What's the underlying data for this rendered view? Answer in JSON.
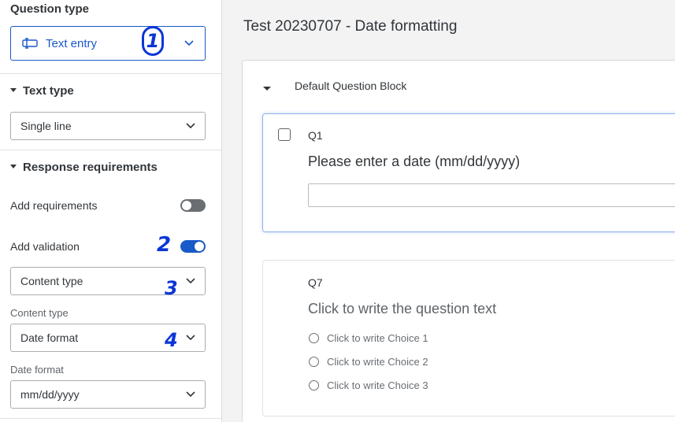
{
  "sidebar": {
    "question_type": {
      "heading": "Question type",
      "selected": "Text entry",
      "icon": "text-entry-icon"
    },
    "text_type": {
      "heading": "Text type",
      "selected": "Single line"
    },
    "response_requirements": {
      "heading": "Response requirements",
      "add_requirements_label": "Add requirements",
      "add_requirements_on": false,
      "add_validation_label": "Add validation",
      "add_validation_on": true,
      "validation_selected": "Content type",
      "content_type_label": "Content type",
      "content_type_selected": "Date format",
      "date_format_label": "Date format",
      "date_format_selected": "mm/dd/yyyy"
    }
  },
  "annotations": [
    "1",
    "2",
    "3",
    "4"
  ],
  "main": {
    "survey_title": "Test 20230707 - Date formatting",
    "block_name": "Default Question Block",
    "questions": [
      {
        "number": "Q1",
        "text": "Please enter a date (mm/dd/yyyy)"
      },
      {
        "number": "Q7",
        "text": "Click to write the question text",
        "choices": [
          "Click to write Choice 1",
          "Click to write Choice 2",
          "Click to write Choice 3"
        ]
      }
    ]
  },
  "colors": {
    "accent": "#1a59c8",
    "annotation": "#0a36d6",
    "toggle_off": "#6a6e73"
  }
}
